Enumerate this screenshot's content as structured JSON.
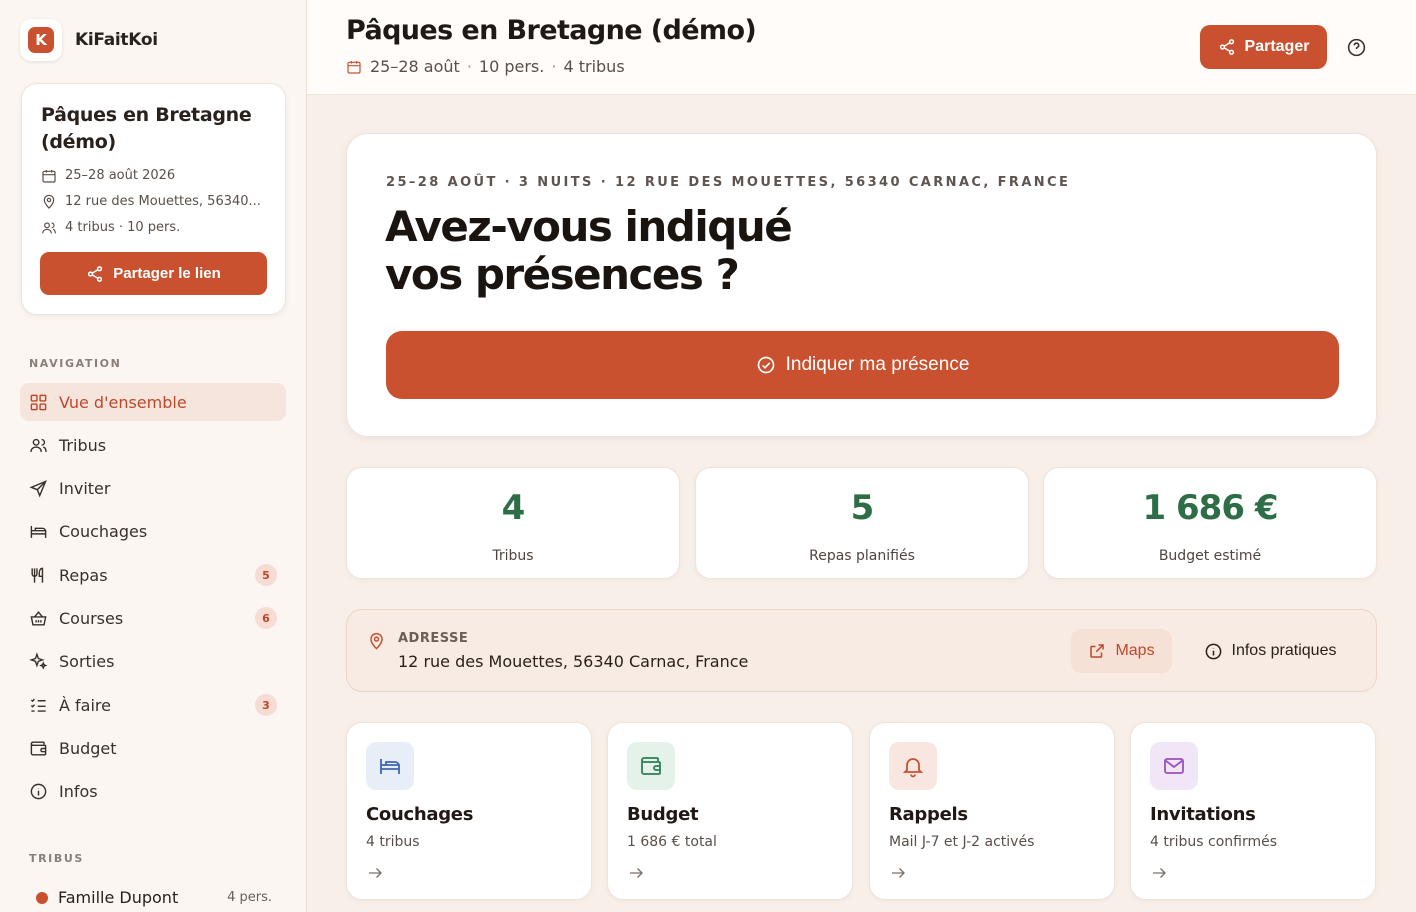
{
  "app": {
    "name": "KiFaitKoi",
    "logo_letter": "K",
    "accent": "#c9512f",
    "success": "#2e6e46"
  },
  "sidebar": {
    "event": {
      "title": "Pâques en Bretagne (démo)",
      "dates": "25–28 août 2026",
      "address": "12 rue des Mouettes, 56340...",
      "summary": "4 tribus · 10 pers.",
      "share_label": "Partager le lien"
    },
    "nav_heading": "NAVIGATION",
    "nav": [
      {
        "label": "Vue d'ensemble",
        "icon": "grid-icon",
        "active": true
      },
      {
        "label": "Tribus",
        "icon": "users-icon"
      },
      {
        "label": "Inviter",
        "icon": "send-icon"
      },
      {
        "label": "Couchages",
        "icon": "bed-icon"
      },
      {
        "label": "Repas",
        "icon": "utensils-icon",
        "badge": "5"
      },
      {
        "label": "Courses",
        "icon": "basket-icon",
        "badge": "6"
      },
      {
        "label": "Sorties",
        "icon": "sparkles-icon"
      },
      {
        "label": "À faire",
        "icon": "checklist-icon",
        "badge": "3"
      },
      {
        "label": "Budget",
        "icon": "wallet-icon"
      },
      {
        "label": "Infos",
        "icon": "info-icon"
      }
    ],
    "tribes_heading": "TRIBUS",
    "tribes": [
      {
        "name": "Famille Dupont",
        "count": "4 pers.",
        "color": "#c9512f"
      }
    ]
  },
  "header": {
    "title": "Pâques en Bretagne (démo)",
    "dates": "25–28 août",
    "people": "10 pers.",
    "tribes": "4 tribus",
    "separator": "·",
    "share_label": "Partager"
  },
  "hero": {
    "eyebrow": "25–28 août · 3 nuits · 12 rue des Mouettes, 56340 Carnac, France",
    "title_line1": "Avez-vous indiqué",
    "title_line2": "vos présences ?",
    "cta_label": "Indiquer ma présence"
  },
  "stats": [
    {
      "value": "4",
      "label": "Tribus"
    },
    {
      "value": "5",
      "label": "Repas planifiés"
    },
    {
      "value": "1 686 €",
      "label": "Budget estimé"
    }
  ],
  "address": {
    "label": "ADRESSE",
    "value": "12 rue des Mouettes, 56340 Carnac, France",
    "maps_label": "Maps",
    "info_label": "Infos pratiques"
  },
  "features": [
    {
      "title": "Couchages",
      "subtitle": "4 tribus",
      "icon": "bed-icon",
      "tint": "#e8eef8",
      "color": "#3f66b4"
    },
    {
      "title": "Budget",
      "subtitle": "1 686 € total",
      "icon": "wallet-icon",
      "tint": "#e4f2ea",
      "color": "#2e7d55"
    },
    {
      "title": "Rappels",
      "subtitle": "Mail J-7 et J-2 activés",
      "icon": "bell-icon",
      "tint": "#fae6e0",
      "color": "#c9512f"
    },
    {
      "title": "Invitations",
      "subtitle": "4 tribus confirmés",
      "icon": "mail-icon",
      "tint": "#f1e6f7",
      "color": "#9b4fc2"
    }
  ]
}
